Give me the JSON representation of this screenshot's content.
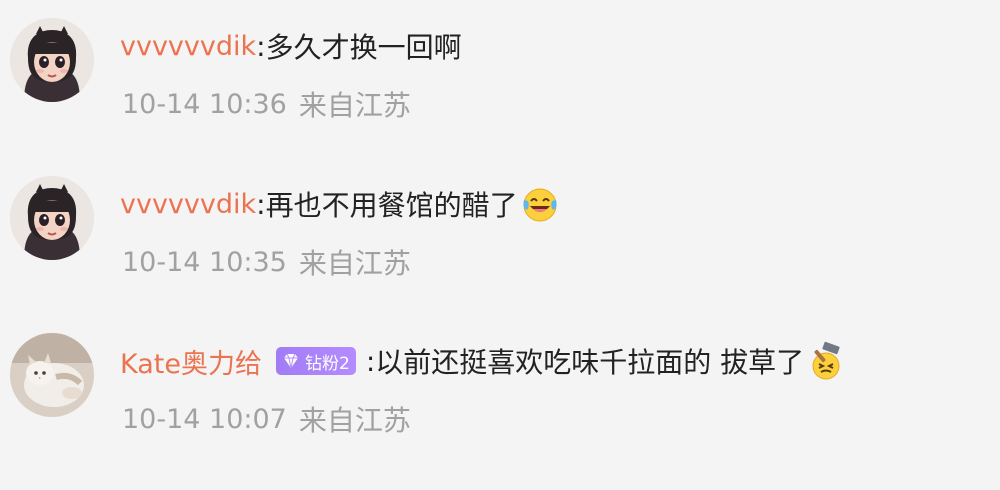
{
  "comments": [
    {
      "user": "vvvvvvdik",
      "separator": ":",
      "text": "多久才换一回啊",
      "time": "10-14 10:36",
      "source": "来自江苏",
      "avatar": "cartoon-girl-avatar"
    },
    {
      "user": "vvvvvvdik",
      "separator": ":",
      "text": "再也不用餐馆的醋了",
      "emoji": "laughing-crying-emoji",
      "time": "10-14 10:35",
      "source": "来自江苏",
      "avatar": "cartoon-girl-avatar"
    },
    {
      "user": "Kate奥力给",
      "badge": "钻粉2",
      "separator": ":",
      "text": "以前还挺喜欢吃味千拉面的 拔草了",
      "emoji": "hammer-face-emoji",
      "time": "10-14 10:07",
      "source": "来自江苏",
      "avatar": "cat-photo-avatar"
    }
  ],
  "colors": {
    "username": "#eb7350",
    "meta": "#a1a1a1",
    "badge": "#a27cf5",
    "background": "#f4f4f4"
  }
}
